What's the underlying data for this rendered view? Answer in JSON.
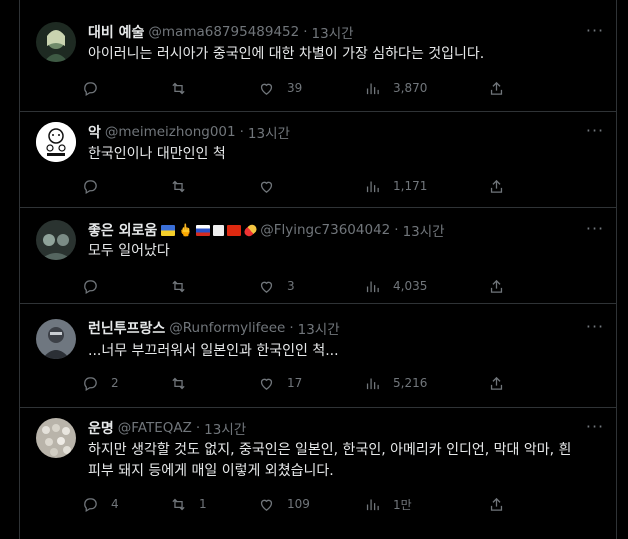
{
  "tweets": [
    {
      "name": "대비 예술",
      "handle": "@mama68795489452",
      "time": "13시간",
      "text": "아이러니는 러시아가 중국인에 대한 차별이 가장 심하다는 것입니다.",
      "reply_count": "",
      "retweet_count": "",
      "like_count": "39",
      "view_count": "3,870"
    },
    {
      "name": "악",
      "handle": "@meimeizhong001",
      "time": "13시간",
      "text": "한국인이나 대만인인 척",
      "reply_count": "",
      "retweet_count": "",
      "like_count": "",
      "view_count": "1,171"
    },
    {
      "name": "좋은 외로움",
      "handle": "@Flyingc73604042",
      "time": "13시간",
      "text": "모두 일어났다",
      "reply_count": "",
      "retweet_count": "",
      "like_count": "3",
      "view_count": "4,035"
    },
    {
      "name": "런닌투프랑스",
      "handle": "@Runformylifeee",
      "time": "13시간",
      "text": "...너무 부끄러워서 일본인과 한국인인 척...",
      "reply_count": "2",
      "retweet_count": "",
      "like_count": "17",
      "view_count": "5,216"
    },
    {
      "name": "운명",
      "handle": "@FATEQAZ",
      "time": "13시간",
      "text": "하지만 생각할 것도 없지, 중국인은 일본인, 한국인, 아메리카 인디언, 막대 악마, 흰 피부 돼지 등에게 매일 이렇게 외쳤습니다.",
      "reply_count": "4",
      "retweet_count": "1",
      "like_count": "109",
      "view_count": "1만"
    }
  ],
  "icons": [
    "reply-icon",
    "retweet-icon",
    "like-icon",
    "views-icon",
    "share-icon",
    "more-icon"
  ],
  "colors": {
    "background": "#000000",
    "text": "#e7e9ea",
    "secondary": "#71767b",
    "border": "#2f3336"
  }
}
